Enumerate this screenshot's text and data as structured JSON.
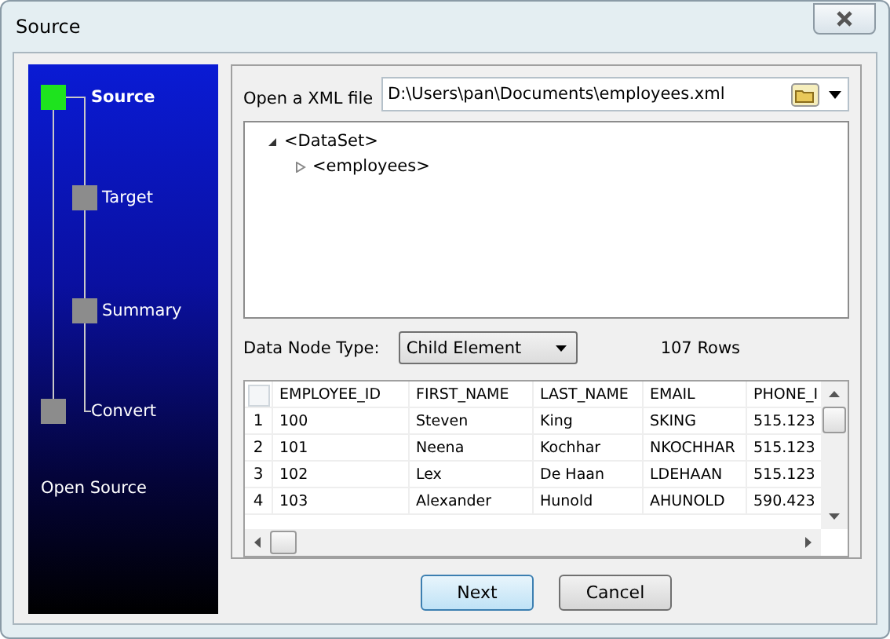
{
  "window": {
    "title": "Source"
  },
  "steps": [
    {
      "label": "Source",
      "selected": true
    },
    {
      "label": "Target",
      "selected": false
    },
    {
      "label": "Summary",
      "selected": false
    },
    {
      "label": "Convert",
      "selected": false
    }
  ],
  "sidebar_caption": "Open Source",
  "file": {
    "label": "Open a XML file",
    "value": "D:\\Users\\pan\\Documents\\employees.xml"
  },
  "tree": [
    {
      "label": "<DataSet>",
      "expanded": true,
      "children": [
        {
          "label": "<employees>",
          "expanded": false
        }
      ]
    }
  ],
  "node_type": {
    "label": "Data Node Type:",
    "value": "Child Element"
  },
  "row_count": "107 Rows",
  "table": {
    "columns": [
      "EMPLOYEE_ID",
      "FIRST_NAME",
      "LAST_NAME",
      "EMAIL",
      "PHONE_I"
    ],
    "rows": [
      {
        "index": "1",
        "cells": [
          "100",
          "Steven",
          "King",
          "SKING",
          "515.123"
        ]
      },
      {
        "index": "2",
        "cells": [
          "101",
          "Neena",
          "Kochhar",
          "NKOCHHAR",
          "515.123"
        ]
      },
      {
        "index": "3",
        "cells": [
          "102",
          "Lex",
          "De Haan",
          "LDEHAAN",
          "515.123"
        ]
      },
      {
        "index": "4",
        "cells": [
          "103",
          "Alexander",
          "Hunold",
          "AHUNOLD",
          "590.423"
        ]
      }
    ]
  },
  "buttons": [
    {
      "label": "Next",
      "selected": true
    },
    {
      "label": "Cancel",
      "selected": false
    }
  ]
}
